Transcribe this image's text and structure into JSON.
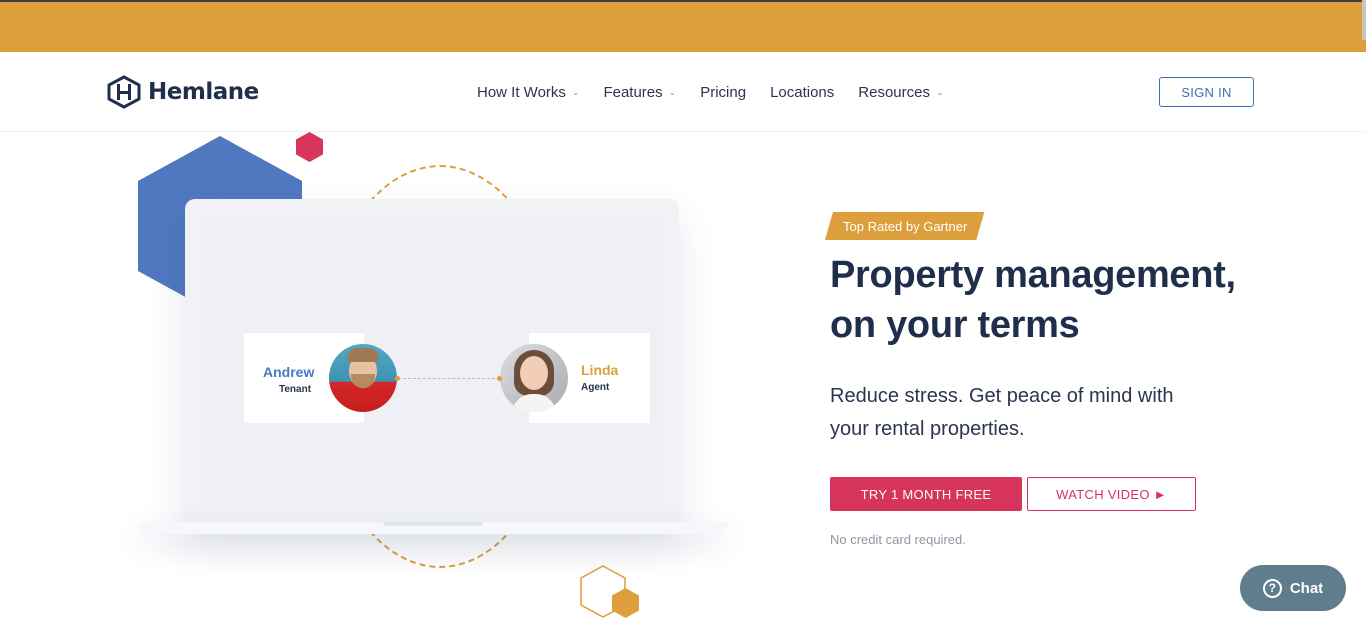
{
  "brand": {
    "name": "Hemlane"
  },
  "nav": {
    "items": [
      {
        "label": "How It Works",
        "has_dropdown": true
      },
      {
        "label": "Features",
        "has_dropdown": true
      },
      {
        "label": "Pricing",
        "has_dropdown": false
      },
      {
        "label": "Locations",
        "has_dropdown": false
      },
      {
        "label": "Resources",
        "has_dropdown": true
      }
    ],
    "dropdown_glyph": "⌄",
    "signin_label": "SIGN IN"
  },
  "hero": {
    "badge": "Top Rated by Gartner",
    "headline": "Property management, on your terms",
    "subheadline": "Reduce stress. Get peace of mind with your rental properties.",
    "cta_primary": "TRY 1 MONTH FREE",
    "cta_secondary": "WATCH VIDEO ►",
    "note": "No credit card required."
  },
  "illustration": {
    "tenant": {
      "name": "Andrew",
      "role": "Tenant"
    },
    "agent": {
      "name": "Linda",
      "role": "Agent"
    }
  },
  "chat": {
    "label": "Chat",
    "icon": "?"
  },
  "colors": {
    "banner": "#dc9f3b",
    "brand_navy": "#1f2e4a",
    "primary_red": "#d6345a",
    "link_blue": "#3f6fb5",
    "hex_blue": "#5078c0",
    "accent_gold": "#dc9f3b",
    "chat_bg": "#5f7d8c"
  }
}
